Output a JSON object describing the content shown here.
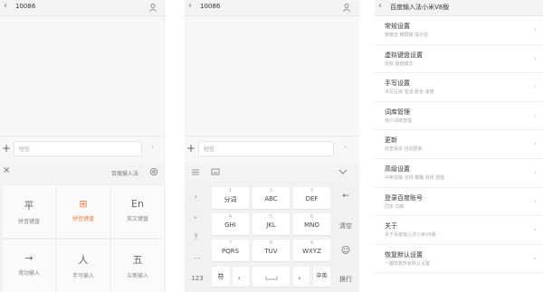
{
  "screen1": {
    "title": "10086",
    "input_placeholder": "短信",
    "keyboard_name": "百度输入法",
    "modes": [
      {
        "glyph": "平",
        "label": "拼音键盘",
        "selected": false
      },
      {
        "glyph": "⊞",
        "label": "拼音键盘",
        "selected": true
      },
      {
        "glyph": "En",
        "label": "英文键盘",
        "selected": false
      },
      {
        "glyph": "→",
        "label": "滑动输入",
        "selected": false
      },
      {
        "glyph": "人",
        "label": "手写输入",
        "selected": false
      },
      {
        "glyph": "五",
        "label": "五笔输入",
        "selected": false
      }
    ]
  },
  "screen2": {
    "title": "10086",
    "input_placeholder": "短信",
    "left_keys": [
      "，",
      "。",
      "？",
      "…"
    ],
    "keys": [
      {
        "num": "1",
        "txt": "分词"
      },
      {
        "num": "2",
        "txt": "ABC"
      },
      {
        "num": "3",
        "txt": "DEF"
      },
      {
        "num": "4",
        "txt": "GHI"
      },
      {
        "num": "5",
        "txt": "JKL"
      },
      {
        "num": "6",
        "txt": "MNO"
      },
      {
        "num": "7",
        "txt": "PQRS"
      },
      {
        "num": "8",
        "txt": "TUV"
      },
      {
        "num": "9",
        "txt": "WXYZ"
      }
    ],
    "right_keys": [
      "←",
      "清空",
      "☺",
      "换行"
    ],
    "bottom": {
      "numbers": "123",
      "symbol": "符",
      "comma": "，",
      "space": "",
      "dot": "。",
      "lang": "中英"
    }
  },
  "screen3": {
    "title": "百度输入法小米V8版",
    "items": [
      {
        "title": "常规设置",
        "subtitle": "按键音  横屏键  提示音"
      },
      {
        "title": "虚拟键盘设置",
        "subtitle": "皮肤  键盘模式"
      },
      {
        "title": "手写设置",
        "subtitle": "书写区域  笔迹  颜色  速度"
      },
      {
        "title": "词库管理",
        "subtitle": "用户词库管理"
      },
      {
        "title": "更新",
        "subtitle": "检查版本  自动更新"
      },
      {
        "title": "高级设置",
        "subtitle": "中英混输  全拼  模糊  双拼  智能"
      },
      {
        "title": "登录百度账号",
        "subtitle": "同步  词库"
      },
      {
        "title": "关于",
        "subtitle": "关于百度输入法小米V8版"
      },
      {
        "title": "恢复默认设置",
        "subtitle": "一键恢复所有默认设置"
      }
    ]
  }
}
